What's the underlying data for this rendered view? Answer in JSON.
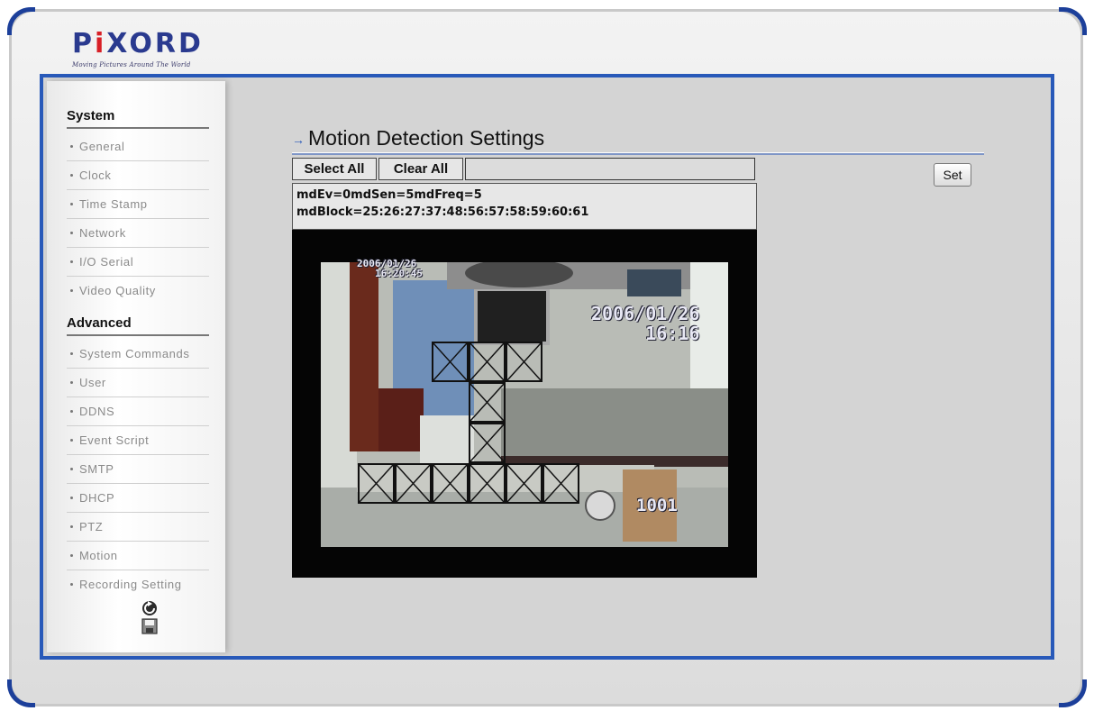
{
  "brand": {
    "name_start": "P",
    "name_dot_letter": "i",
    "name_end": "XORD",
    "tagline": "Moving Pictures Around The World"
  },
  "sidebar": {
    "system_heading": "System",
    "system_items": [
      {
        "label": "General"
      },
      {
        "label": "Clock"
      },
      {
        "label": "Time Stamp"
      },
      {
        "label": "Network"
      },
      {
        "label": "I/O Serial"
      },
      {
        "label": "Video Quality"
      }
    ],
    "advanced_heading": "Advanced",
    "advanced_items": [
      {
        "label": "System Commands"
      },
      {
        "label": "User"
      },
      {
        "label": "DDNS"
      },
      {
        "label": "Event Script"
      },
      {
        "label": "SMTP"
      },
      {
        "label": "DHCP"
      },
      {
        "label": "PTZ"
      },
      {
        "label": "Motion"
      },
      {
        "label": "Recording Setting"
      }
    ],
    "icons": [
      "refresh-icon",
      "save-icon"
    ]
  },
  "main": {
    "title": "Motion Detection Settings",
    "select_all_label": "Select All",
    "clear_all_label": "Clear All",
    "block_input_value": "",
    "set_label": "Set",
    "params_line1": "mdEv=0mdSen=5mdFreq=5",
    "params_line2": "mdBlock=25:26:27:37:48:56:57:58:59:60:61",
    "video": {
      "osd_date_small": "2006/01/26",
      "osd_time_small": "16:20:45",
      "osd_date_large": "2006/01/26",
      "osd_time_large": "16:16",
      "wall_number": "1001"
    }
  },
  "colors": {
    "frame_blue": "#2859b9",
    "corner_navy": "#1c3f9a",
    "brand_blue": "#2a3a8f",
    "brand_red": "#d81f26"
  }
}
